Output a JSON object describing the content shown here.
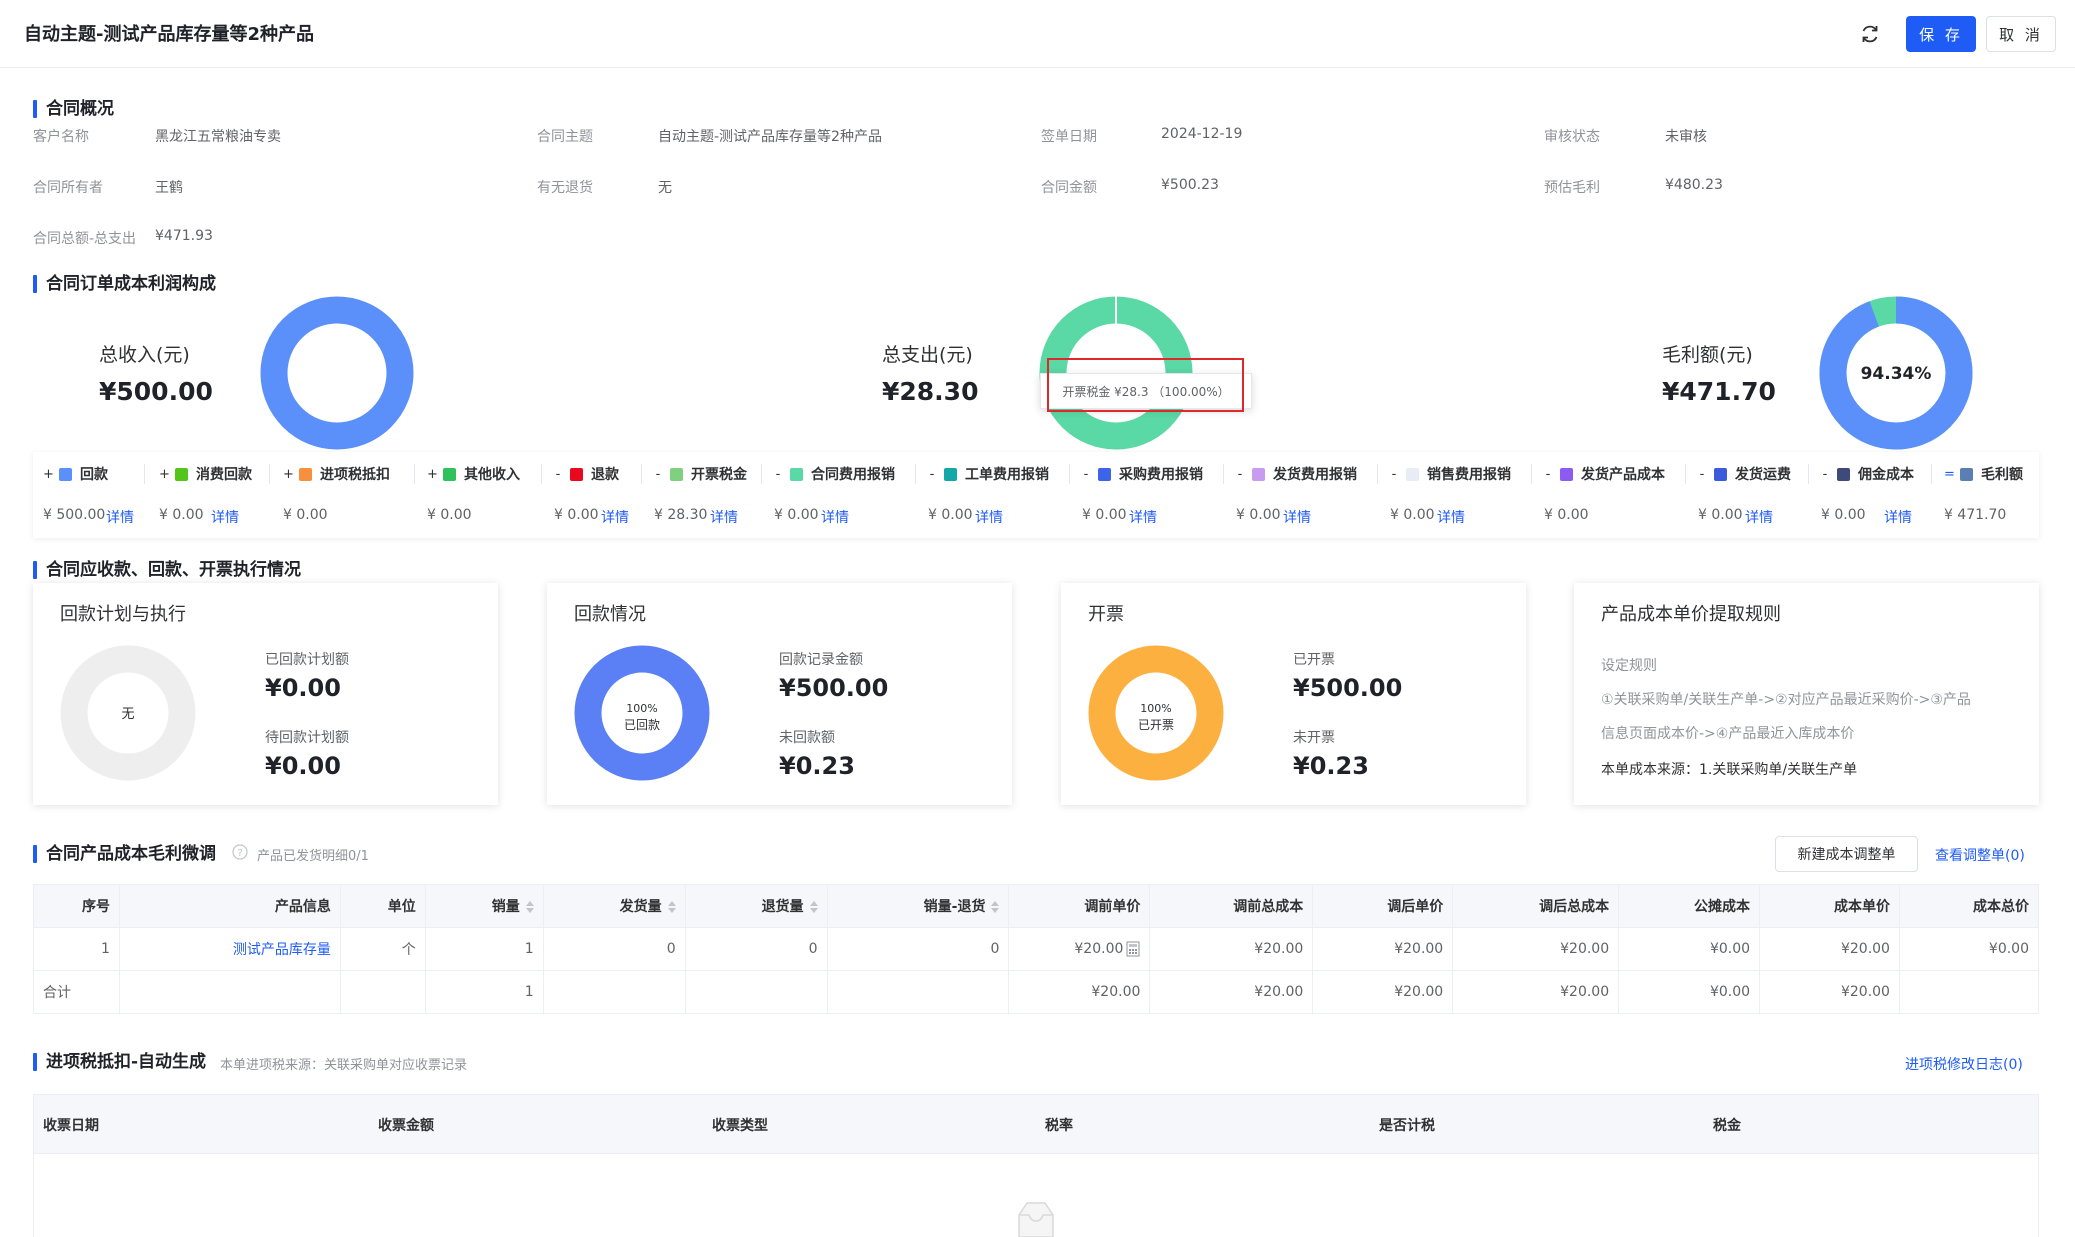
{
  "header": {
    "title": "自动主题-测试产品库存量等2种产品",
    "save_label": "保 存",
    "cancel_label": "取 消"
  },
  "overview": {
    "section_title": "合同概况",
    "fields": [
      {
        "label": "客户名称",
        "value": "黑龙江五常粮油专卖"
      },
      {
        "label": "合同主题",
        "value": "自动主题-测试产品库存量等2种产品"
      },
      {
        "label": "签单日期",
        "value": "2024-12-19"
      },
      {
        "label": "审核状态",
        "value": "未审核"
      },
      {
        "label": "合同所有者",
        "value": "王鹤"
      },
      {
        "label": "有无退货",
        "value": "无"
      },
      {
        "label": "合同金额",
        "value": "¥500.23"
      },
      {
        "label": "预估毛利",
        "value": "¥480.23"
      },
      {
        "label": "合同总额-总支出",
        "value": "¥471.93"
      }
    ]
  },
  "profit": {
    "section_title": "合同订单成本利润构成",
    "income": {
      "label": "总收入(元)",
      "value": "¥500.00",
      "color": "#5b8ff9"
    },
    "expense": {
      "label": "总支出(元)",
      "value": "¥28.30",
      "color": "#5ad8a6"
    },
    "margin": {
      "label": "毛利额(元)",
      "value": "¥471.70",
      "percent": "94.34%",
      "percent_value": 94.34,
      "color": "#5b8ff9",
      "rest_color": "#5ad8a6"
    },
    "tooltip": "开票税金 ¥28.3 （100.00%）"
  },
  "categories": [
    {
      "op": "+",
      "name": "回款",
      "color": "#5b8ff9",
      "value": "¥ 500.00",
      "link": "详情"
    },
    {
      "op": "+",
      "name": "消费回款",
      "color": "#52c41a",
      "value": "¥ 0.00",
      "link": "详情"
    },
    {
      "op": "+",
      "name": "进项税抵扣",
      "color": "#f6903d",
      "value": "¥ 0.00",
      "link": ""
    },
    {
      "op": "+",
      "name": "其他收入",
      "color": "#2fc25b",
      "value": "¥ 0.00",
      "link": ""
    },
    {
      "op": "-",
      "name": "退款",
      "color": "#e8091e",
      "value": "¥ 0.00",
      "link": "详情"
    },
    {
      "op": "-",
      "name": "开票税金",
      "color": "#7fd17f",
      "value": "¥ 28.30",
      "link": "详情"
    },
    {
      "op": "-",
      "name": "合同费用报销",
      "color": "#5ad8a6",
      "value": "¥ 0.00",
      "link": "详情"
    },
    {
      "op": "-",
      "name": "工单费用报销",
      "color": "#13a8a8",
      "value": "¥ 0.00",
      "link": "详情"
    },
    {
      "op": "-",
      "name": "采购费用报销",
      "color": "#3d64e8",
      "value": "¥ 0.00",
      "link": "详情"
    },
    {
      "op": "-",
      "name": "发货费用报销",
      "color": "#c99bf0",
      "value": "¥ 0.00",
      "link": "详情"
    },
    {
      "op": "-",
      "name": "销售费用报销",
      "color": "#e8ecf5",
      "value": "¥ 0.00",
      "link": "详情"
    },
    {
      "op": "-",
      "name": "发货产品成本",
      "color": "#8c5cf2",
      "value": "¥ 0.00",
      "link": ""
    },
    {
      "op": "-",
      "name": "发货运费",
      "color": "#3b5bdb",
      "value": "¥ 0.00",
      "link": "详情"
    },
    {
      "op": "-",
      "name": "佣金成本",
      "color": "#3d4a7a",
      "value": "¥ 0.00",
      "link": "详情"
    },
    {
      "op": "=",
      "name": "毛利额",
      "color": "#5b7fb5",
      "value": "¥ 471.70",
      "link": ""
    }
  ],
  "execution": {
    "section_title": "合同应收款、回款、开票执行情况",
    "plan": {
      "title": "回款计划与执行",
      "center": "无",
      "label1": "已回款计划额",
      "value1": "¥0.00",
      "label2": "待回款计划额",
      "value2": "¥0.00"
    },
    "payment": {
      "title": "回款情况",
      "center_pct": "100%",
      "center_text": "已回款",
      "label1": "回款记录金额",
      "value1": "¥500.00",
      "label2": "未回款额",
      "value2": "¥0.23",
      "color": "#5b7ff5"
    },
    "invoice": {
      "title": "开票",
      "center_pct": "100%",
      "center_text": "已开票",
      "label1": "已开票",
      "value1": "¥500.00",
      "label2": "未开票",
      "value2": "¥0.23",
      "color": "#fcb040"
    },
    "rule": {
      "title": "产品成本单价提取规则",
      "subtitle": "设定规则",
      "line1": "①关联采购单/关联生产单->②对应产品最近采购价->③产品",
      "line2": "信息页面成本价->④产品最近入库成本价",
      "source": "本单成本来源：1.关联采购单/关联生产单"
    }
  },
  "products": {
    "section_title": "合同产品成本毛利微调",
    "subtitle": "产品已发货明细0/1",
    "new_button": "新建成本调整单",
    "view_link": "查看调整单(0)",
    "columns": [
      "序号",
      "产品信息",
      "单位",
      "销量",
      "发货量",
      "退货量",
      "销量-退货",
      "调前单价",
      "调前总成本",
      "调后单价",
      "调后总成本",
      "公摊成本",
      "成本单价",
      "成本总价"
    ],
    "row": [
      "1",
      "测试产品库存量",
      "个",
      "1",
      "0",
      "0",
      "0",
      "¥20.00",
      "¥20.00",
      "¥20.00",
      "¥20.00",
      "¥0.00",
      "¥20.00",
      "¥0.00"
    ],
    "total": [
      "合计",
      "",
      "",
      "1",
      "",
      "",
      "",
      "¥20.00",
      "¥20.00",
      "¥20.00",
      "¥20.00",
      "¥0.00",
      "¥20.00",
      ""
    ]
  },
  "tax": {
    "section_title": "进项税抵扣-自动生成",
    "subtitle": "本单进项税来源：关联采购单对应收票记录",
    "log_link": "进项税修改日志(0)",
    "columns": [
      "收票日期",
      "收票金额",
      "收票类型",
      "税率",
      "是否计税",
      "税金"
    ]
  }
}
